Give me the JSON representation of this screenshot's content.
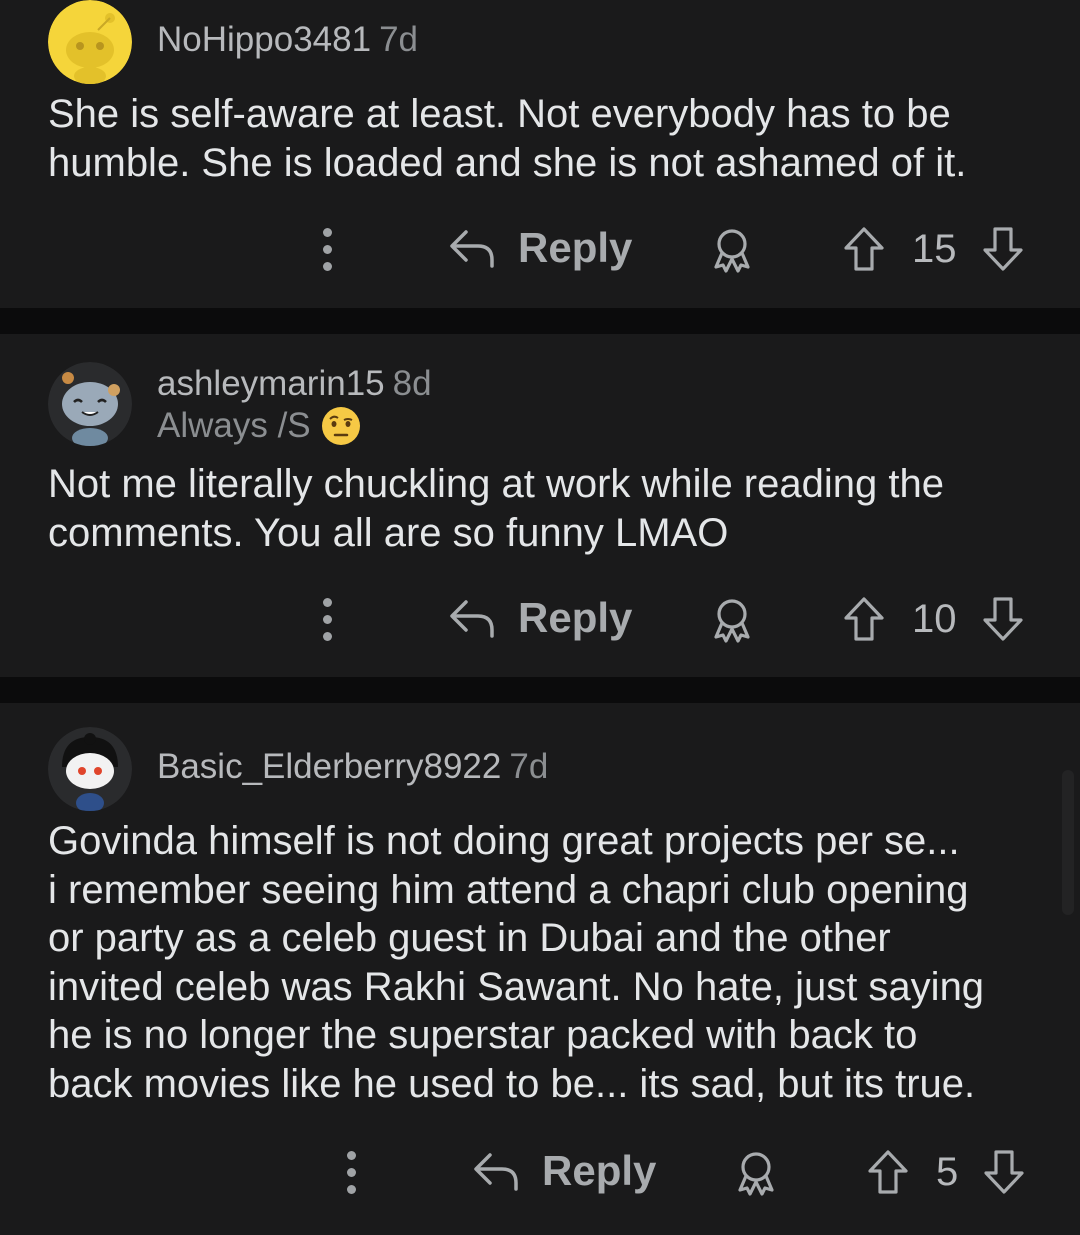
{
  "comments": [
    {
      "username": "NoHippo3481",
      "age": "7d",
      "flair": "",
      "lines": [
        "She is self-aware at least. Not everybody has to be",
        "humble. She is loaded and she is not ashamed of it."
      ],
      "reply_label": "Reply",
      "score": "15",
      "avatar_icon": "snoo-yellow-avatar-icon"
    },
    {
      "username": "ashleymarin15",
      "age": "8d",
      "flair": "Always /S",
      "lines": [
        "Not me literally chuckling at work while reading the",
        "comments. You all are so funny LMAO"
      ],
      "reply_label": "Reply",
      "score": "10",
      "avatar_icon": "snoo-blue-avatar-icon"
    },
    {
      "username": "Basic_Elderberry8922",
      "age": "7d",
      "flair": "",
      "lines": [
        "Govinda himself is not doing great projects per se...",
        "i remember seeing him attend a chapri club opening",
        "or party as a celeb guest in Dubai and the other",
        "invited celeb was Rakhi Sawant. No hate, just saying",
        "he is no longer the superstar packed with back to",
        "back movies like he used to be... its sad, but its true."
      ],
      "reply_label": "Reply",
      "score": "5",
      "avatar_icon": "snoo-black-hair-avatar-icon"
    }
  ],
  "icons": {
    "more": "more-vertical-icon",
    "reply": "reply-arrow-icon",
    "award": "award-icon",
    "upvote": "upvote-arrow-icon",
    "downvote": "downvote-arrow-icon"
  },
  "colors": {
    "background": "#1a1a1b",
    "separator": "#0b0b0c",
    "text": "#e4e6e8",
    "muted": "#8b8e91"
  }
}
